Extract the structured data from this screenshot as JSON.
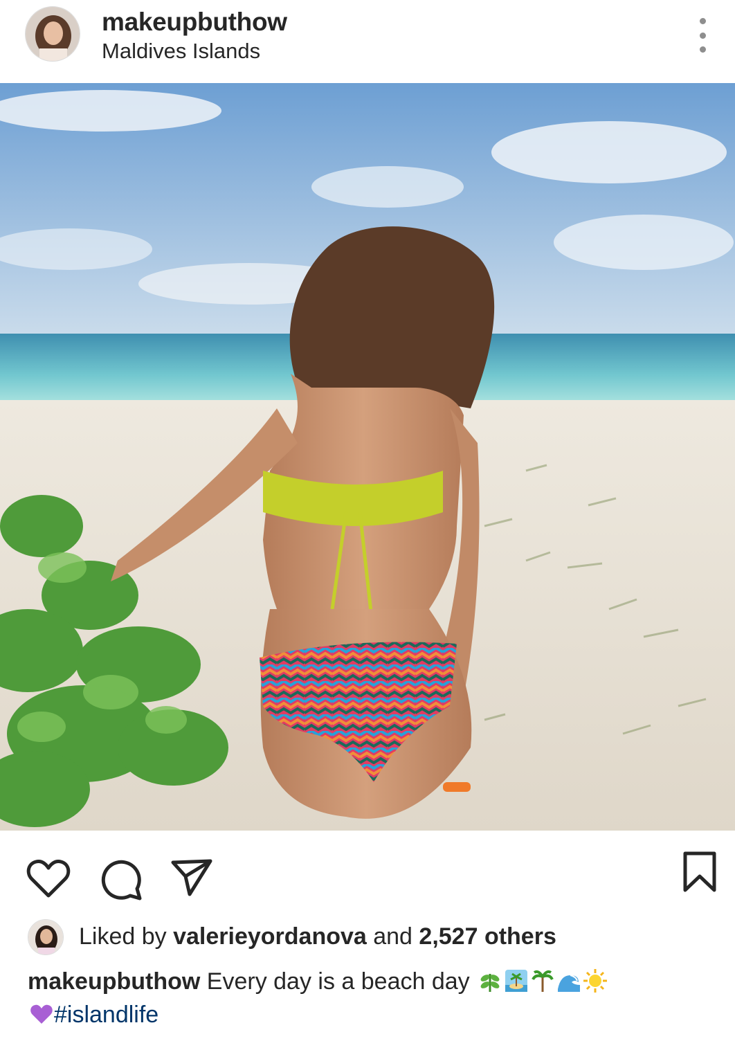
{
  "post": {
    "username": "makeupbuthow",
    "location": "Maldives Islands"
  },
  "likes": {
    "prefix": "Liked by ",
    "liker": "valerieyordanova",
    "middle": " and ",
    "count_text": "2,527 others"
  },
  "caption": {
    "username": "makeupbuthow",
    "text": " Every day is a beach day ",
    "emojis": [
      "seedling",
      "desert-island",
      "palm-tree",
      "wave",
      "sun",
      "purple-heart"
    ],
    "hashtag": "#islandlife"
  },
  "icons": [
    "more-options-icon",
    "heart-icon",
    "comment-icon",
    "share-icon",
    "bookmark-icon"
  ],
  "colors": {
    "text": "#262626",
    "secondary": "#8e8e8e",
    "hashtag": "#003569"
  }
}
